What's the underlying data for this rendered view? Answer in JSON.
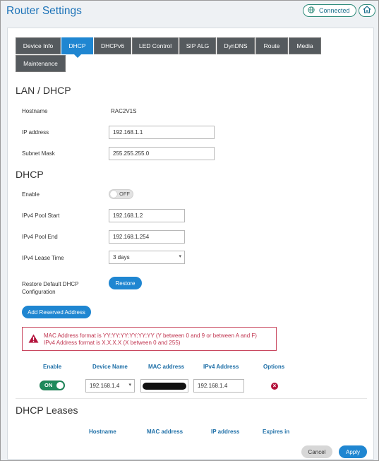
{
  "header": {
    "title": "Router Settings",
    "status_label": "Connected"
  },
  "tabs": [
    {
      "label": "Device Info"
    },
    {
      "label": "DHCP"
    },
    {
      "label": "DHCPv6"
    },
    {
      "label": "LED Control"
    },
    {
      "label": "SIP ALG"
    },
    {
      "label": "DynDNS"
    },
    {
      "label": "Route"
    },
    {
      "label": "Media"
    },
    {
      "label": "Maintenance"
    }
  ],
  "lan": {
    "title": "LAN / DHCP",
    "hostname_label": "Hostname",
    "hostname_value": "RAC2V1S",
    "ip_label": "IP address",
    "ip_value": "192.168.1.1",
    "mask_label": "Subnet Mask",
    "mask_value": "255.255.255.0"
  },
  "dhcp": {
    "title": "DHCP",
    "enable_label": "Enable",
    "enable_state": "OFF",
    "pool_start_label": "IPv4 Pool Start",
    "pool_start_value": "192.168.1.2",
    "pool_end_label": "IPv4 Pool End",
    "pool_end_value": "192.168.1.254",
    "lease_label": "IPv4 Lease Time",
    "lease_value": "3 days",
    "restore_label_line1": "Restore Default DHCP",
    "restore_label_line2": "Configuration",
    "restore_button": "Restore",
    "add_reserved_button": "Add Reserved Address"
  },
  "warning": {
    "line1": "MAC Address format is YY:YY:YY:YY:YY:YY (Y between 0 and 9 or between A and F)",
    "line2": "IPv4 Address format is X.X.X.X (X between 0 and 255)"
  },
  "reserved_table": {
    "headers": [
      "Enable",
      "Device Name",
      "MAC address",
      "IPv4 Address",
      "Options"
    ],
    "row": {
      "enable_state": "ON",
      "device_name": "192.168.1.4",
      "ipv4": "192.168.1.4"
    }
  },
  "leases": {
    "title": "DHCP Leases",
    "headers": [
      "Hostname",
      "MAC address",
      "IP address",
      "Expires in"
    ]
  },
  "footer": {
    "cancel": "Cancel",
    "apply": "Apply"
  },
  "colors": {
    "accent": "#1f86d1",
    "tab_inactive": "#555a5e",
    "toggle_on": "#1e8a5c",
    "warning": "#c0344f"
  }
}
